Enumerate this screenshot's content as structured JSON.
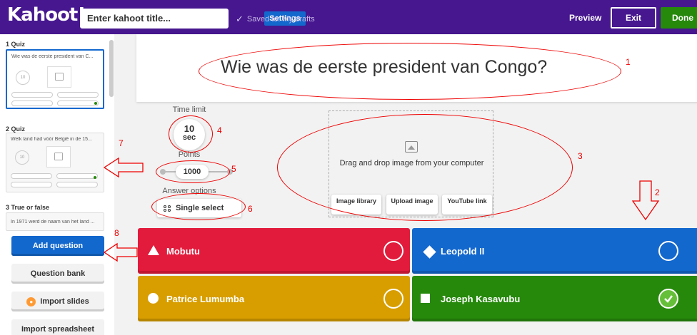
{
  "topbar": {
    "logo": "Kahoot!",
    "title_placeholder": "Enter kahoot title...",
    "settings_label": "Settings",
    "saved_text": "Saved to: My drafts",
    "preview_label": "Preview",
    "exit_label": "Exit",
    "done_label": "Done"
  },
  "sidebar": {
    "slides": [
      {
        "head": "1 Quiz",
        "question": "Wie was de eerste president van C...",
        "timer": "10"
      },
      {
        "head": "2 Quiz",
        "question": "Welk land had vóór België in de 15...",
        "timer": "10"
      },
      {
        "head": "3 True or false",
        "question": "In 1971 werd de naam van het land ..."
      }
    ],
    "add_question": "Add question",
    "question_bank": "Question bank",
    "import_slides": "Import slides",
    "import_spreadsheet": "Import spreadsheet"
  },
  "editor": {
    "question": "Wie was de eerste president van Congo?",
    "time_limit_label": "Time limit",
    "time_value": "10",
    "time_unit": "sec",
    "points_label": "Points",
    "points_value": "1000",
    "answer_options_label": "Answer options",
    "answer_options_value": "Single select",
    "media_text": "Drag and drop image from your computer",
    "media_buttons": [
      "Image library",
      "Upload image",
      "YouTube link"
    ],
    "answers": [
      {
        "text": "Mobutu",
        "color": "#e21b3c",
        "shape": "triangle",
        "correct": false
      },
      {
        "text": "Leopold II",
        "color": "#1368ce",
        "shape": "diamond",
        "correct": false
      },
      {
        "text": "Patrice Lumumba",
        "color": "#d89e00",
        "shape": "circle",
        "correct": false
      },
      {
        "text": "Joseph Kasavubu",
        "color": "#26890c",
        "shape": "square",
        "correct": true
      }
    ]
  },
  "annotations": [
    "1",
    "2",
    "3",
    "4",
    "5",
    "6",
    "7",
    "8"
  ]
}
